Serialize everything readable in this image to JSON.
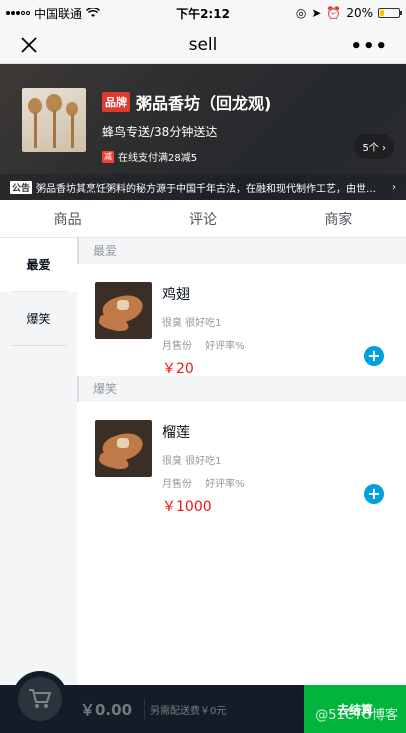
{
  "status_bar": {
    "carrier": "中国联通",
    "time": "下午2:12",
    "battery": "20%",
    "battery_level": 0.2
  },
  "nav": {
    "title": "sell"
  },
  "seller": {
    "brand_tag": "品牌",
    "name": "粥品香坊（回龙观)",
    "delivery": "蜂鸟专送/38分钟送达",
    "support_icon": "减",
    "support_text": "在线支付满28减5",
    "support_count": "5个 ›",
    "bulletin_tag": "公告",
    "bulletin": "粥品香坊其烹饪粥料的秘方源于中国千年古法，在融和现代制作工艺，由世…",
    "bulletin_arrow": "›"
  },
  "tabs": [
    "商品",
    "评论",
    "商家"
  ],
  "menu": [
    "最爱",
    "爆笑"
  ],
  "sections": [
    {
      "title": "最爱",
      "foods": [
        {
          "name": "鸡翅",
          "desc": "很臭 很好吃1",
          "sell": "月售份",
          "rating": "好评率%",
          "price": "￥20"
        }
      ]
    },
    {
      "title": "爆笑",
      "foods": [
        {
          "name": "榴莲",
          "desc": "很臭 很好吃1",
          "sell": "月售份",
          "rating": "好评率%",
          "price": "￥1000"
        }
      ]
    }
  ],
  "cart": {
    "price": "￥0.00",
    "desc": "另需配送费￥0元",
    "pay": "去结算",
    "watermark": "@51CTO博客"
  }
}
